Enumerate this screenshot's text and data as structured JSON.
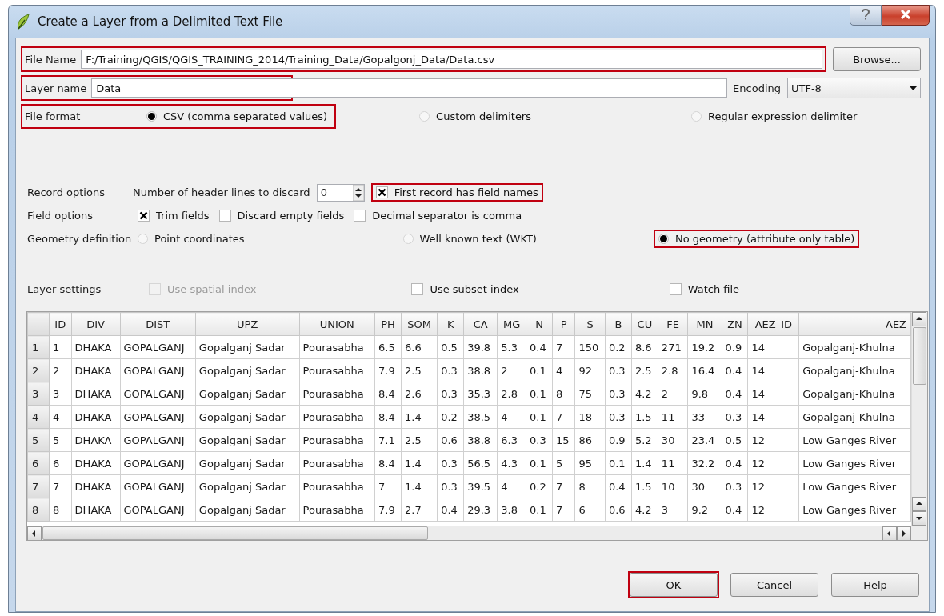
{
  "window": {
    "title": "Create a Layer from a Delimited Text File"
  },
  "file_name": {
    "label": "File Name",
    "value": "F:/Training/QGIS/QGIS_TRAINING_2014/Training_Data/Gopalgonj_Data/Data.csv",
    "highlighted": true
  },
  "browse_button": "Browse...",
  "layer_name": {
    "label": "Layer name",
    "value": "Data",
    "highlighted": true
  },
  "encoding": {
    "label": "Encoding",
    "value": "UTF-8"
  },
  "file_format": {
    "label": "File format",
    "highlighted": true,
    "options": [
      {
        "label": "CSV (comma separated values)",
        "selected": true
      },
      {
        "label": "Custom delimiters",
        "selected": false
      },
      {
        "label": "Regular expression delimiter",
        "selected": false
      }
    ]
  },
  "record_options": {
    "label": "Record options",
    "header_lines_label": "Number of header lines to discard",
    "header_lines": "0",
    "checkboxes": [
      {
        "label": "First record has field names",
        "checked": true,
        "disabled": false,
        "highlighted": true
      }
    ]
  },
  "field_options": {
    "label": "Field options",
    "checkboxes": [
      {
        "label": "Trim fields",
        "checked": true,
        "disabled": false,
        "highlighted": false
      },
      {
        "label": "Discard empty fields",
        "checked": false,
        "disabled": false,
        "highlighted": false
      },
      {
        "label": "Decimal separator is comma",
        "checked": false,
        "disabled": false,
        "highlighted": false
      }
    ]
  },
  "geometry": {
    "label": "Geometry definition",
    "options": [
      {
        "label": "Point coordinates",
        "selected": false,
        "highlighted": false
      },
      {
        "label": "Well known text (WKT)",
        "selected": false,
        "highlighted": false
      },
      {
        "label": "No geometry (attribute only table)",
        "selected": true,
        "highlighted": true
      }
    ]
  },
  "layer_settings": {
    "label": "Layer settings",
    "checkboxes": [
      {
        "label": "Use spatial index",
        "checked": false,
        "disabled": true,
        "highlighted": false
      },
      {
        "label": "Use subset index",
        "checked": false,
        "disabled": false,
        "highlighted": false
      },
      {
        "label": "Watch file",
        "checked": false,
        "disabled": false,
        "highlighted": false
      }
    ]
  },
  "table": {
    "columns": [
      "ID",
      "DIV",
      "DIST",
      "UPZ",
      "UNION",
      "PH",
      "SOM",
      "K",
      "CA",
      "MG",
      "N",
      "P",
      "S",
      "B",
      "CU",
      "FE",
      "MN",
      "ZN",
      "AEZ_ID",
      "AEZ"
    ],
    "rows": [
      {
        "number": "1",
        "cells": [
          "1",
          "DHAKA",
          "GOPALGANJ",
          "Gopalganj Sadar",
          "Pourasabha",
          "6.5",
          "6.6",
          "0.5",
          "39.8",
          "5.3",
          "0.4",
          "7",
          "150",
          "0.2",
          "8.6",
          "271",
          "19.2",
          "0.9",
          "14",
          "Gopalganj-Khulna"
        ]
      },
      {
        "number": "2",
        "cells": [
          "2",
          "DHAKA",
          "GOPALGANJ",
          "Gopalganj Sadar",
          "Pourasabha",
          "7.9",
          "2.5",
          "0.3",
          "38.8",
          "2",
          "0.1",
          "4",
          "92",
          "0.3",
          "2.5",
          "2.8",
          "16.4",
          "0.4",
          "14",
          "Gopalganj-Khulna"
        ]
      },
      {
        "number": "3",
        "cells": [
          "3",
          "DHAKA",
          "GOPALGANJ",
          "Gopalganj Sadar",
          "Pourasabha",
          "8.4",
          "2.6",
          "0.3",
          "35.3",
          "2.8",
          "0.1",
          "8",
          "75",
          "0.3",
          "4.2",
          "2",
          "9.8",
          "0.4",
          "14",
          "Gopalganj-Khulna"
        ]
      },
      {
        "number": "4",
        "cells": [
          "4",
          "DHAKA",
          "GOPALGANJ",
          "Gopalganj Sadar",
          "Pourasabha",
          "8.4",
          "1.4",
          "0.2",
          "38.5",
          "4",
          "0.1",
          "7",
          "18",
          "0.3",
          "1.5",
          "11",
          "33",
          "0.3",
          "14",
          "Gopalganj-Khulna"
        ]
      },
      {
        "number": "5",
        "cells": [
          "5",
          "DHAKA",
          "GOPALGANJ",
          "Gopalganj Sadar",
          "Pourasabha",
          "7.1",
          "2.5",
          "0.6",
          "38.8",
          "6.3",
          "0.3",
          "15",
          "86",
          "0.9",
          "5.2",
          "30",
          "23.4",
          "0.5",
          "12",
          "Low Ganges River"
        ]
      },
      {
        "number": "6",
        "cells": [
          "6",
          "DHAKA",
          "GOPALGANJ",
          "Gopalganj Sadar",
          "Pourasabha",
          "8.4",
          "1.4",
          "0.3",
          "56.5",
          "4.3",
          "0.1",
          "5",
          "95",
          "0.1",
          "1.4",
          "11",
          "32.2",
          "0.4",
          "12",
          "Low Ganges River"
        ]
      },
      {
        "number": "7",
        "cells": [
          "7",
          "DHAKA",
          "GOPALGANJ",
          "Gopalganj Sadar",
          "Pourasabha",
          "7",
          "1.4",
          "0.3",
          "39.5",
          "4",
          "0.2",
          "7",
          "8",
          "0.4",
          "1.5",
          "10",
          "30",
          "0.3",
          "12",
          "Low Ganges River"
        ]
      },
      {
        "number": "8",
        "cells": [
          "8",
          "DHAKA",
          "GOPALGANJ",
          "Gopalganj Sadar",
          "Pourasabha",
          "7.9",
          "2.7",
          "0.4",
          "29.3",
          "3.8",
          "0.1",
          "7",
          "6",
          "0.6",
          "4.2",
          "3",
          "9.2",
          "0.4",
          "12",
          "Low Ganges River"
        ]
      }
    ]
  },
  "buttons": [
    {
      "label": "OK",
      "highlighted": true
    },
    {
      "label": "Cancel",
      "highlighted": false
    },
    {
      "label": "Help",
      "highlighted": false
    }
  ]
}
